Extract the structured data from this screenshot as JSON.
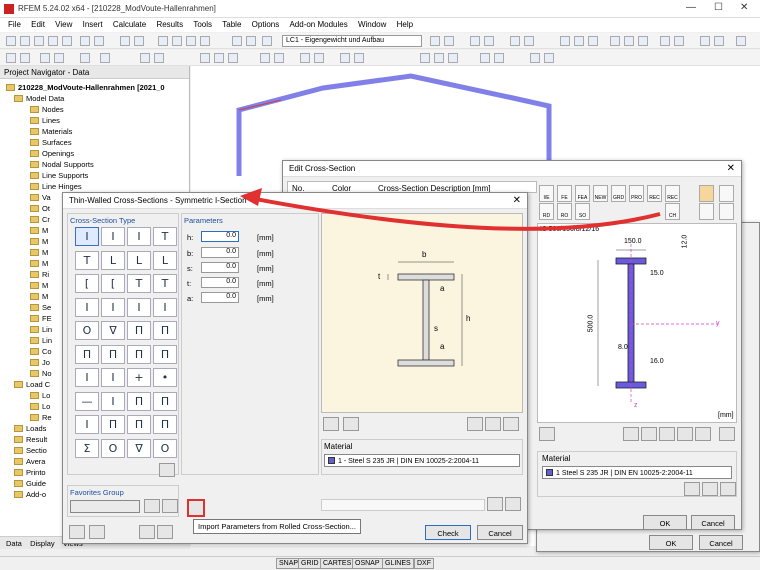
{
  "window": {
    "title": "RFEM 5.24.02 x64 - [210228_ModVoute-Hallenrahmen]"
  },
  "menu": [
    "File",
    "Edit",
    "View",
    "Insert",
    "Calculate",
    "Results",
    "Tools",
    "Table",
    "Options",
    "Add-on Modules",
    "Window",
    "Help"
  ],
  "toolbar": {
    "load_case": "LC1 - Eigengewicht und Aufbau"
  },
  "navigator": {
    "title": "Project Navigator - Data",
    "root": "210228_ModVoute-Hallenrahmen [2021_0",
    "items": [
      "Model Data",
      "Nodes",
      "Lines",
      "Materials",
      "Surfaces",
      "Openings",
      "Nodal Supports",
      "Line Supports",
      "Line Hinges",
      "Va",
      "Ot",
      "Cr",
      "M",
      "M",
      "M",
      "M",
      "Ri",
      "M",
      "M",
      "Se",
      "FE",
      "Lin",
      "Lin",
      "Co",
      "Jo",
      "No",
      "Load C",
      "Lo",
      "Lo",
      "Re",
      "Loads",
      "Result",
      "Sectio",
      "Avera",
      "Printo",
      "Guide",
      "Add-o"
    ],
    "tabs": [
      "Data",
      "Display",
      "Views"
    ]
  },
  "edit_dialog": {
    "title": "Edit Cross-Section",
    "columns": [
      "No.",
      "Color",
      "Cross-Section Description [mm]"
    ],
    "description": "IS 500/150/8/12/16",
    "dims": {
      "top_width": "150.0",
      "top_flange": "12.0",
      "top_fillet": "15.0",
      "height": "500.0",
      "web": "8.0",
      "bottom_fillet": "16.0"
    },
    "axis_y": "y",
    "axis_z": "z",
    "unit": "[mm]",
    "material_label": "Material",
    "material_value": "1  Steel S 235 JR  | DIN EN 10025-2:2004-11",
    "ok": "OK",
    "cancel": "Cancel",
    "tool_labels": [
      "I/E",
      "FE",
      "FEA",
      "NEW",
      "GRD",
      "PRO",
      "REC",
      "REC",
      "RD",
      "RO",
      "SO",
      "CH"
    ]
  },
  "back_dialog": {
    "ok": "OK",
    "cancel": "Cancel"
  },
  "thin_dialog": {
    "title": "Thin-Walled Cross-Sections - Symmetric I-Section",
    "type_label": "Cross-Section Type",
    "params_label": "Parameters",
    "params": [
      {
        "name": "h:",
        "value": "0.0",
        "unit": "[mm]"
      },
      {
        "name": "b:",
        "value": "0.0",
        "unit": "[mm]"
      },
      {
        "name": "s:",
        "value": "0.0",
        "unit": "[mm]"
      },
      {
        "name": "t:",
        "value": "0.0",
        "unit": "[mm]"
      },
      {
        "name": "a:",
        "value": "0.0",
        "unit": "[mm]"
      }
    ],
    "sketch_labels": {
      "b": "b",
      "t": "t",
      "a": "a",
      "h": "h",
      "s": "s"
    },
    "favorites_label": "Favorites Group",
    "material_label": "Material",
    "material_value": "1 - Steel S 235 JR | DIN EN 10025-2:2004-11",
    "check": "Check",
    "cancel": "Cancel",
    "tooltip": "Import Parameters from Rolled Cross-Section...",
    "type_icons": [
      "I",
      "I",
      "I",
      "T",
      "T",
      "L",
      "L",
      "L",
      "[",
      "[",
      "T",
      "T",
      "I",
      "I",
      "I",
      "I",
      "O",
      "∇",
      "Π",
      "Π",
      "Π",
      "Π",
      "Π",
      "Π",
      "I",
      "I",
      "+",
      "•",
      "—",
      "I",
      "Π",
      "Π",
      "I",
      "Π",
      "Π",
      "Π",
      "Σ",
      "O",
      "∇",
      "O"
    ]
  },
  "statusbar": [
    "SNAP",
    "GRID",
    "CARTES",
    "OSNAP",
    "GLINES",
    "DXF"
  ],
  "colors": {
    "accent": "#2b6cc4",
    "arrow": "#e03030",
    "frame": "#8080e8"
  }
}
